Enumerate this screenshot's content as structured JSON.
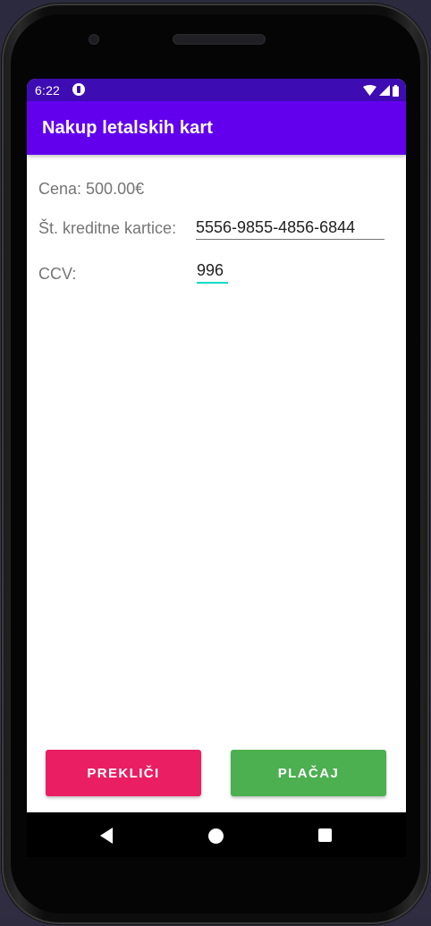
{
  "status_bar": {
    "time": "6:22",
    "app_icon": "notification-app-icon",
    "icons": [
      "wifi-icon",
      "signal-icon",
      "battery-icon"
    ]
  },
  "toolbar": {
    "title": "Nakup letalskih kart"
  },
  "form": {
    "price_label": "Cena: 500.00€",
    "card_label": "Št. kreditne kartice:",
    "card_value": "5556-9855-4856-6844",
    "ccv_label": "CCV:",
    "ccv_value": "996"
  },
  "buttons": {
    "cancel_label": "PREKLIČI",
    "pay_label": "PLAČAJ"
  },
  "nav": {
    "icons": [
      "back-icon",
      "home-icon",
      "recents-icon"
    ]
  },
  "colors": {
    "status_bar": "#3e0cb3",
    "toolbar": "#6200ee",
    "cancel_button": "#e91e63",
    "pay_button": "#4caf50",
    "focus_accent": "#03dac5"
  }
}
